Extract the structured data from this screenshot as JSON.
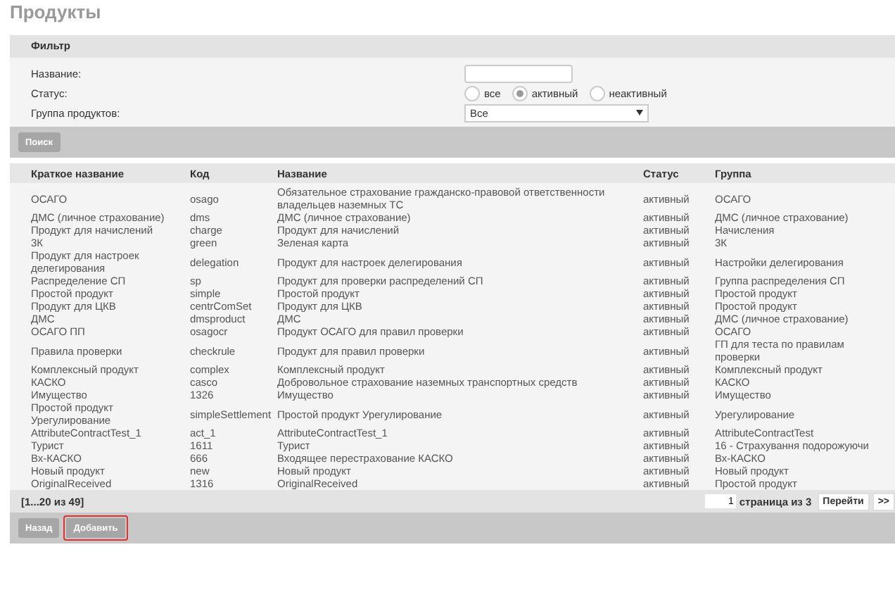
{
  "title": "Продукты",
  "filter": {
    "header": "Фильтр",
    "name_label": "Название:",
    "status_label": "Статус:",
    "status_options": [
      {
        "label": "все",
        "selected": false
      },
      {
        "label": "активный",
        "selected": true
      },
      {
        "label": "неактивный",
        "selected": false
      }
    ],
    "group_label": "Группа продуктов:",
    "group_value": "Все",
    "search_button": "Поиск"
  },
  "table": {
    "columns": [
      "Краткое название",
      "Код",
      "Название",
      "Статус",
      "Группа"
    ],
    "rows": [
      [
        "ОСАГО",
        "osago",
        "Обязательное страхование гражданско-правовой ответственности владельцев наземных ТС",
        "активный",
        "ОСАГО"
      ],
      [
        "ДМС (личное страхование)",
        "dms",
        "ДМС (личное страхование)",
        "активный",
        "ДМС (личное страхование)"
      ],
      [
        "Продукт для начислений",
        "charge",
        "Продукт для начислений",
        "активный",
        "Начисления"
      ],
      [
        "3К",
        "green",
        "Зеленая карта",
        "активный",
        "3К"
      ],
      [
        "Продукт для настроек делегирования",
        "delegation",
        "Продукт для настроек делегирования",
        "активный",
        "Настройки делегирования"
      ],
      [
        "Распределение СП",
        "sp",
        "Продукт для проверки распределений СП",
        "активный",
        "Группа распределения СП"
      ],
      [
        "Простой продукт",
        "simple",
        "Простой продукт",
        "активный",
        "Простой продукт"
      ],
      [
        "Продукт для ЦКВ",
        "centrComSet",
        "Продукт для ЦКВ",
        "активный",
        "Простой продукт"
      ],
      [
        "ДМС",
        "dmsproduct",
        "ДМС",
        "активный",
        "ДМС (личное страхование)"
      ],
      [
        "ОСАГО ПП",
        "osagocr",
        "Продукт ОСАГО для правил проверки",
        "активный",
        "ОСАГО"
      ],
      [
        "Правила проверки",
        "checkrule",
        "Продукт для правил проверки",
        "активный",
        "ГП для теста по правилам проверки"
      ],
      [
        "Комплексный продукт",
        "complex",
        "Комплексный продукт",
        "активный",
        "Комплексный продукт"
      ],
      [
        "КАСКО",
        "casco",
        "Добровольное страхование наземных транспортных средств",
        "активный",
        "КАСКО"
      ],
      [
        "Имущество",
        "1326",
        "Имущество",
        "активный",
        "Имущество"
      ],
      [
        "Простой продукт Урегулирование",
        "simpleSettlement",
        "Простой продукт Урегулирование",
        "активный",
        "Урегулирование"
      ],
      [
        "AttributeContractTest_1",
        "act_1",
        "AttributeContractTest_1",
        "активный",
        "AttributeContractTest"
      ],
      [
        "Турист",
        "1611",
        "Турист",
        "активный",
        "16 - Страхування подорожуючи"
      ],
      [
        "Вх-КАСКО",
        "666",
        "Входящее перестрахование КАСКО",
        "активный",
        "Вх-КАСКО"
      ],
      [
        "Новый продукт",
        "new",
        "Новый продукт",
        "активный",
        "Новый продукт"
      ],
      [
        "OriginalReceived",
        "1316",
        "OriginalReceived",
        "активный",
        "Простой продукт"
      ]
    ]
  },
  "pager": {
    "range": "[1...20 из 49]",
    "page_value": "1",
    "page_label": "страница из 3",
    "go_button": "Перейти",
    "next_button": ">>"
  },
  "buttons": [
    {
      "label": "Назад",
      "highlighted": false
    },
    {
      "label": "Добавить",
      "highlighted": true
    }
  ]
}
